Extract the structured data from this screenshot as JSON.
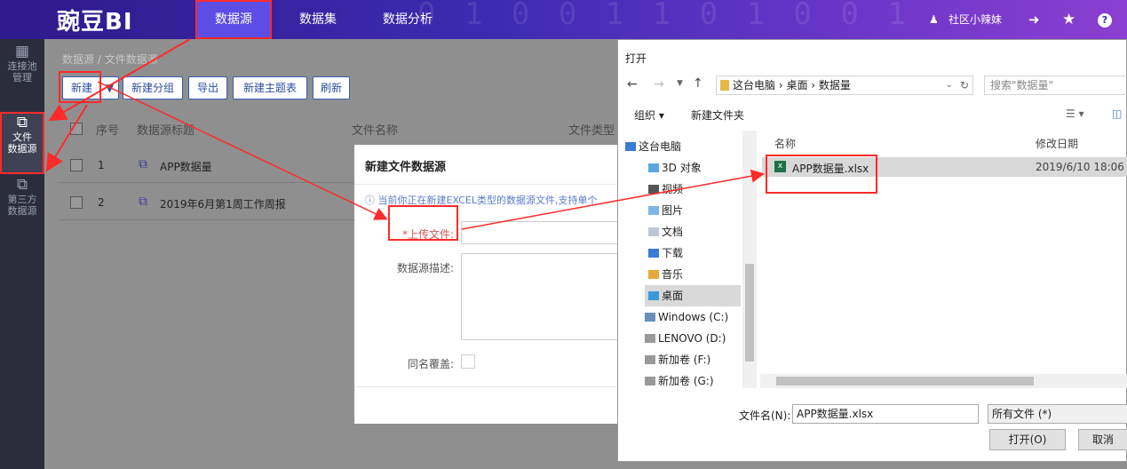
{
  "header": {
    "logo": "豌豆BI",
    "nav": [
      "数据源",
      "数据集",
      "数据分析"
    ],
    "user": "社区小辣妹"
  },
  "sidebar": {
    "items": [
      {
        "label1": "连接池",
        "label2": "管理"
      },
      {
        "label1": "文件",
        "label2": "数据源"
      },
      {
        "label1": "第三方",
        "label2": "数据源"
      }
    ]
  },
  "breadcrumb": {
    "root": "数据源",
    "sep": "/",
    "current": "文件数据源"
  },
  "toolbar": {
    "new": "新建",
    "new_group": "新建分组",
    "export": "导出",
    "new_topic": "新建主题表",
    "refresh": "刷新"
  },
  "table": {
    "headers": [
      "序号",
      "数据源标题",
      "文件名称",
      "文件类型"
    ],
    "rows": [
      {
        "index": "1",
        "title": "APP数据量"
      },
      {
        "index": "2",
        "title": "2019年6月第1周工作周报"
      }
    ]
  },
  "dialog": {
    "title": "新建文件数据源",
    "hint": "当前你正在新建EXCEL类型的数据源文件,支持单个",
    "upload_label": "*上传文件:",
    "desc_label": "数据源描述:",
    "overwrite_label": "同名覆盖:"
  },
  "open_dialog": {
    "title": "打开",
    "path": [
      "这台电脑",
      "桌面",
      "数据量"
    ],
    "search_placeholder": "搜索\"数据量\"",
    "organize": "组织 ▾",
    "new_folder": "新建文件夹",
    "col_name": "名称",
    "col_date": "修改日期",
    "tree": [
      "这台电脑",
      "3D 对象",
      "视频",
      "图片",
      "文档",
      "下载",
      "音乐",
      "桌面",
      "Windows (C:)",
      "LENOVO (D:)",
      "新加卷 (F:)",
      "新加卷 (G:)"
    ],
    "file_name": "APP数据量.xlsx",
    "file_date": "2019/6/10 18:06",
    "filename_label": "文件名(N):",
    "filename_value": "APP数据量.xlsx",
    "filetype": "所有文件 (*)",
    "open_btn": "打开(O)",
    "cancel_btn": "取消"
  }
}
